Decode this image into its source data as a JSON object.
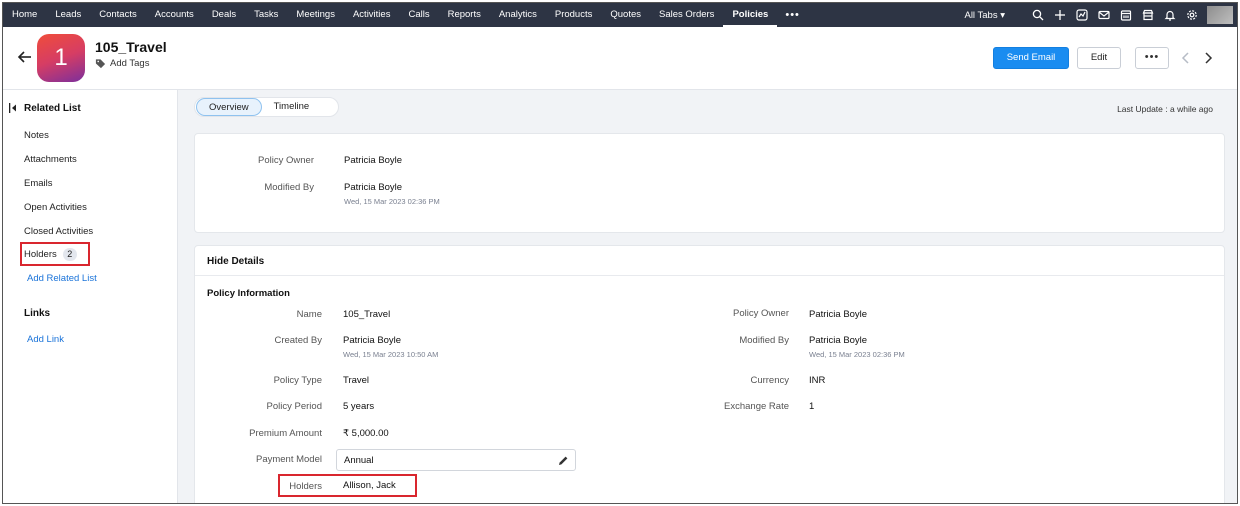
{
  "nav": {
    "items": [
      "Home",
      "Leads",
      "Contacts",
      "Accounts",
      "Deals",
      "Tasks",
      "Meetings",
      "Activities",
      "Calls",
      "Reports",
      "Analytics",
      "Products",
      "Quotes",
      "Sales Orders",
      "Policies"
    ],
    "active": "Policies",
    "more": "•••",
    "all_tabs": "All Tabs ▾"
  },
  "record": {
    "avatar_letter": "1",
    "title": "105_Travel",
    "add_tags": "Add Tags"
  },
  "actions": {
    "send_email": "Send Email",
    "edit": "Edit",
    "more": "•••"
  },
  "sidebar": {
    "related_list_heading": "Related List",
    "items": [
      "Notes",
      "Attachments",
      "Emails",
      "Open Activities",
      "Closed Activities"
    ],
    "holders_label": "Holders",
    "holders_count": "2",
    "add_related_list": "Add Related List",
    "links_heading": "Links",
    "add_link": "Add Link"
  },
  "tabs": {
    "overview": "Overview",
    "timeline": "Timeline"
  },
  "last_update": "Last Update : a while ago",
  "summary": {
    "policy_owner_label": "Policy Owner",
    "policy_owner": "Patricia Boyle",
    "modified_by_label": "Modified By",
    "modified_by": "Patricia Boyle",
    "modified_time": "Wed, 15 Mar 2023 02:36 PM"
  },
  "details": {
    "hide_details": "Hide Details",
    "section": "Policy Information",
    "left": {
      "name_label": "Name",
      "name": "105_Travel",
      "created_by_label": "Created By",
      "created_by": "Patricia Boyle",
      "created_time": "Wed, 15 Mar 2023 10:50 AM",
      "policy_type_label": "Policy Type",
      "policy_type": "Travel",
      "policy_period_label": "Policy Period",
      "policy_period": "5 years",
      "premium_amount_label": "Premium Amount",
      "premium_amount": "₹ 5,000.00",
      "payment_model_label": "Payment Model",
      "payment_model": "Annual",
      "holders_label": "Holders",
      "holders": "Allison, Jack"
    },
    "right": {
      "policy_owner_label": "Policy Owner",
      "policy_owner": "Patricia Boyle",
      "modified_by_label": "Modified By",
      "modified_by": "Patricia Boyle",
      "modified_time": "Wed, 15 Mar 2023 02:36 PM",
      "currency_label": "Currency",
      "currency": "INR",
      "exchange_rate_label": "Exchange Rate",
      "exchange_rate": "1"
    }
  },
  "colors": {
    "nav_bg": "#2d3444",
    "primary": "#1a8cf0",
    "highlight_border": "#d9262e",
    "link": "#1a73d9"
  }
}
